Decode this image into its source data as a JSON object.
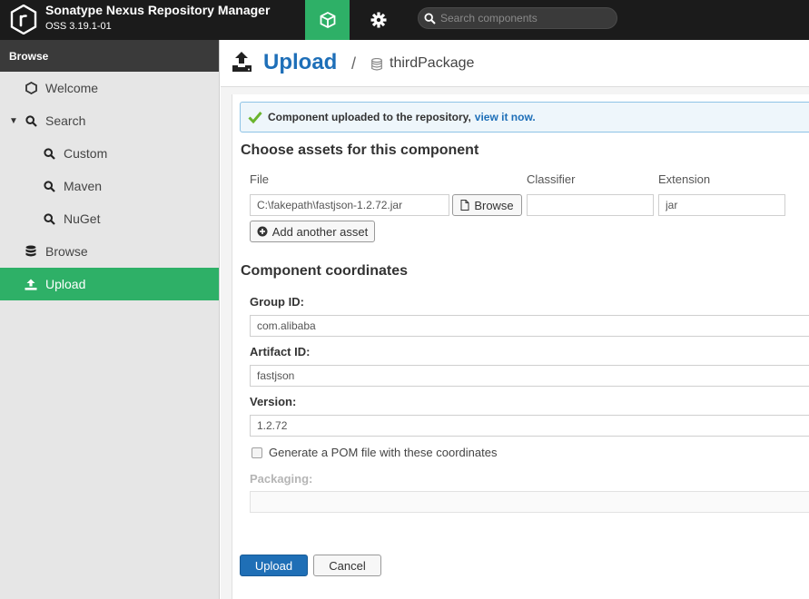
{
  "header": {
    "brand_title": "Sonatype Nexus Repository Manager",
    "brand_version": "OSS 3.19.1-01",
    "browse_icon": "cube-icon",
    "admin_icon": "gear-icon",
    "search_placeholder": "Search components",
    "accent_color": "#2eb067"
  },
  "sidebar": {
    "header": "Browse",
    "items": [
      {
        "label": "Welcome",
        "icon": "hexagon-icon"
      },
      {
        "label": "Search",
        "icon": "search-icon",
        "expanded": true
      },
      {
        "label": "Custom",
        "icon": "search-icon"
      },
      {
        "label": "Maven",
        "icon": "search-icon"
      },
      {
        "label": "NuGet",
        "icon": "search-icon"
      },
      {
        "label": "Browse",
        "icon": "database-icon"
      },
      {
        "label": "Upload",
        "icon": "upload-icon",
        "active": true
      }
    ]
  },
  "page": {
    "title": "Upload",
    "separator": "/",
    "repository": "thirdPackage"
  },
  "alert": {
    "message": "Component uploaded to the repository,",
    "link": "view it now."
  },
  "assets": {
    "section_title": "Choose assets for this component",
    "col_file": "File",
    "col_classifier": "Classifier",
    "col_extension": "Extension",
    "file_value": "C:\\fakepath\\fastjson-1.2.72.jar",
    "browse_label": "Browse",
    "classifier_value": "",
    "extension_value": "jar",
    "add_asset_label": "Add another asset"
  },
  "coordinates": {
    "section_title": "Component coordinates",
    "group_label": "Group ID:",
    "group_value": "com.alibaba",
    "artifact_label": "Artifact ID:",
    "artifact_value": "fastjson",
    "version_label": "Version:",
    "version_value": "1.2.72",
    "pom_label": "Generate a POM file with these coordinates",
    "packaging_label": "Packaging:",
    "packaging_value": ""
  },
  "actions": {
    "upload_label": "Upload",
    "cancel_label": "Cancel"
  }
}
